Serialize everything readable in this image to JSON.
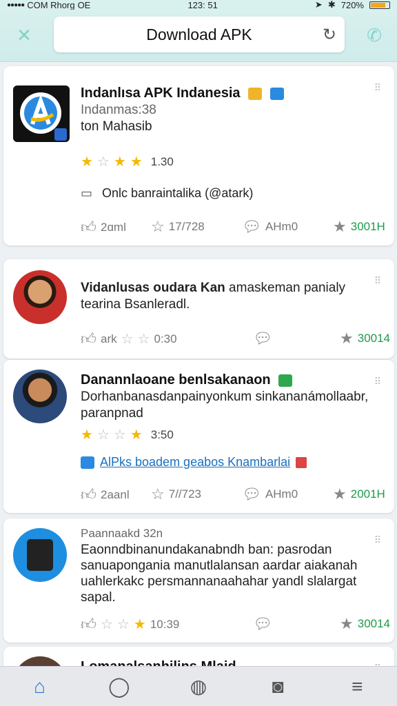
{
  "status_bar": {
    "carrier": "COM Rhorg",
    "network": "OE",
    "time": "123: 51",
    "battery_pct": "720%"
  },
  "header": {
    "search_text": "Download APK"
  },
  "posts": [
    {
      "title": "Indanlısa APK Indanesia",
      "subtitle": "Indanmas:38",
      "text": "ton Mahasib",
      "rating": "1.30",
      "stars": [
        1,
        0,
        1,
        1
      ],
      "link": "Onlc banraintalika (@atark)",
      "likes": "2ɑml",
      "shares": "17/728",
      "comments": "AHm0",
      "count": "3001H"
    },
    {
      "title": "Vidanlusas oudara Kan",
      "text": " amaskeman panialy tearina Bsanleradl.",
      "author": "ark",
      "rating": "0:30",
      "count": "30014"
    },
    {
      "title": "Danannlaoane benlsakanaon",
      "text": "Dorhanbanasdanpainyonkum sinkananámollaabr, paranpnad",
      "rating": "3:50",
      "stars": [
        1,
        0,
        0,
        1
      ],
      "link": "AlPks boadem geabos Knambarlai",
      "likes": "2aanl",
      "shares": "7//723",
      "comments": "AHm0",
      "count": "2001H"
    },
    {
      "header": "Paannaakd 32n",
      "text": "Eaonndbinanundakanabndh ban: pasrodan sanuapongania manutlalansan aardar aiakanah uahlerkakc persmannanaahahar yandl slalargat sapal.",
      "rating": "10:39",
      "stars": [
        0,
        0,
        1
      ],
      "count": "30014"
    },
    {
      "title": "Lomanalsanhilins Mlaid"
    }
  ]
}
